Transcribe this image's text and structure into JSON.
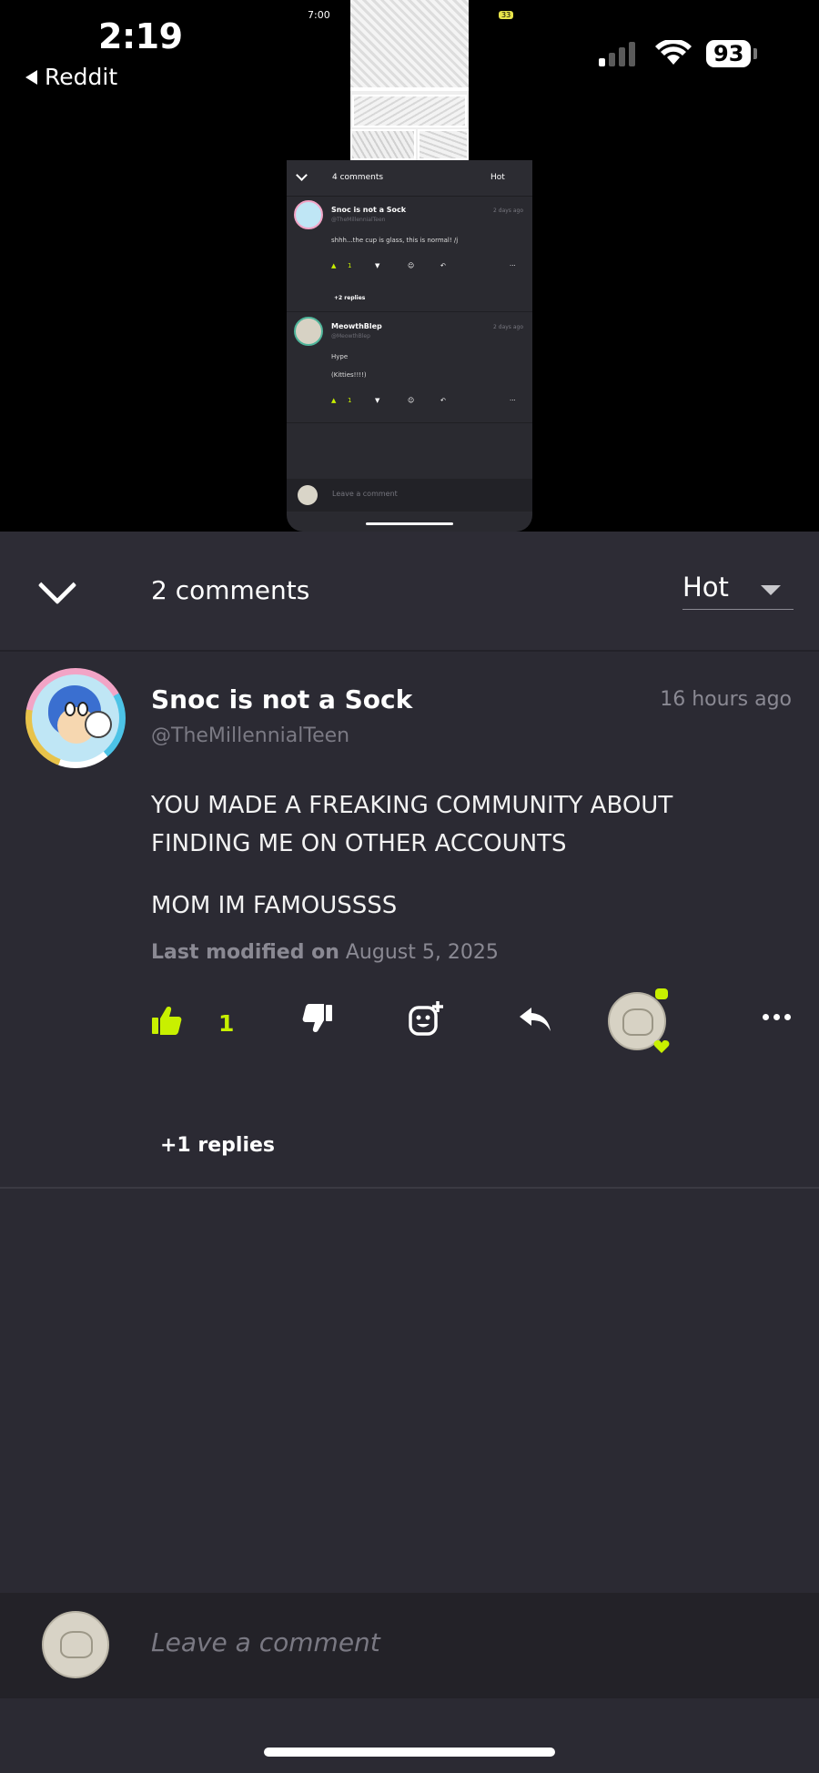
{
  "status_bar": {
    "time": "2:19",
    "back_label": "Reddit",
    "battery": "93",
    "mini_time": "7:00",
    "mini_battery": "33"
  },
  "preview": {
    "comment_count": "4 comments",
    "sort": "Hot",
    "comments": [
      {
        "name": "Snoc is not a Sock",
        "handle": "@TheMillennialTeen",
        "time": "2 days ago",
        "lines": [
          "shhh...the cup is glass, this is normal! /j"
        ],
        "likes": "1",
        "replies": "+2 replies"
      },
      {
        "name": "MeowthBlep",
        "handle": "@MeowthBlep",
        "time": "2 days ago",
        "lines": [
          "Hype",
          "(Kitties!!!!)"
        ],
        "likes": "1"
      }
    ],
    "composer_placeholder": "Leave a comment"
  },
  "header": {
    "comment_count": "2 comments",
    "sort_label": "Hot"
  },
  "comment": {
    "author_name": "Snoc is not a Sock",
    "author_handle": "@TheMillennialTeen",
    "timestamp": "16 hours ago",
    "body": [
      "YOU MADE A FREAKING COMMUNITY ABOUT",
      "FINDING ME ON OTHER ACCOUNTS",
      "MOM IM FAMOUSSSS"
    ],
    "modified_label": "Last modified on",
    "modified_date": "August 5, 2025",
    "like_count": "1",
    "replies_label": "+1 replies"
  },
  "composer": {
    "placeholder": "Leave a comment"
  },
  "colors": {
    "accent": "#c8f000",
    "panel": "#2b2a33",
    "muted_text": "#8a8993"
  },
  "icons": [
    "chevron-down-icon",
    "caret-down-icon",
    "thumbs-up-icon",
    "thumbs-down-icon",
    "add-reaction-icon",
    "reply-icon",
    "more-icon",
    "heart-icon",
    "wifi-icon",
    "signal-icon",
    "battery-icon"
  ]
}
